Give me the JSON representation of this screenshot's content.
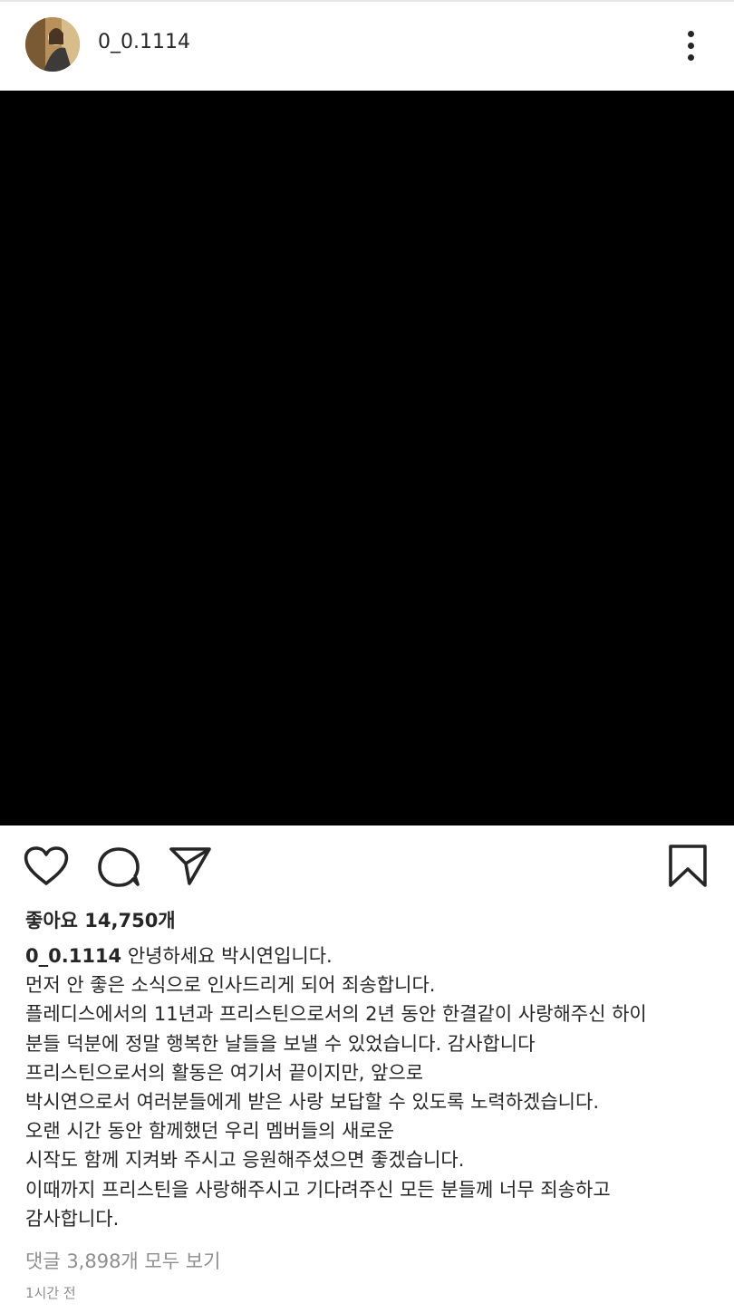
{
  "header": {
    "username": "0_0.1114",
    "avatar_icon": "profile-photo",
    "more_icon": "more-vertical-icon"
  },
  "media": {
    "background": "#000000"
  },
  "actions": {
    "like_icon": "heart-icon",
    "comment_icon": "comment-icon",
    "share_icon": "send-icon",
    "save_icon": "bookmark-icon"
  },
  "likes_text": "좋아요 14,750개",
  "caption": {
    "owner": "0_0.1114",
    "first_line": " 안녕하세요 박시연입니다.",
    "lines": [
      "먼저 안 좋은 소식으로 인사드리게 되어 죄송합니다.",
      "플레디스에서의 11년과 프리스틴으로서의 2년 동안 한결같이 사랑해주신 하이",
      "분들 덕분에 정말 행복한 날들을 보낼 수 있었습니다. 감사합니다",
      "프리스틴으로서의 활동은 여기서 끝이지만, 앞으로",
      "박시연으로서 여러분들에게 받은 사랑 보답할 수 있도록 노력하겠습니다.",
      "오랜 시간 동안 함께했던 우리 멤버들의 새로운",
      "시작도 함께 지켜봐 주시고 응원해주셨으면 좋겠습니다.",
      "이때까지 프리스틴을 사랑해주시고 기다려주신 모든 분들께 너무 죄송하고",
      "감사합니다."
    ]
  },
  "view_comments": "댓글 3,898개 모두 보기",
  "timestamp": "1시간 전",
  "colors": {
    "text": "#262626",
    "muted": "#8e8e8e",
    "media": "#000000"
  }
}
